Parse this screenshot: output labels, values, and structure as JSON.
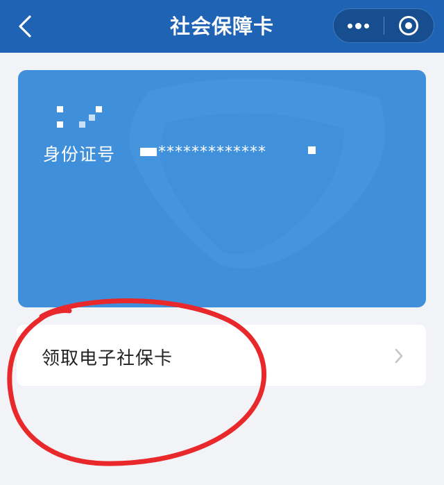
{
  "navbar": {
    "title": "社会保障卡",
    "back_icon": "chevron-left-icon",
    "more_icon": "more-dots-icon",
    "close_icon": "target-circle-icon",
    "background": "#1e63b4"
  },
  "card": {
    "id_label": "身份证号",
    "id_value_masked": "*************",
    "background": "#3f8fdb"
  },
  "claim": {
    "label": "领取电子社保卡",
    "arrow_icon": "chevron-right-icon"
  },
  "annotation": {
    "color": "#e8282b"
  }
}
